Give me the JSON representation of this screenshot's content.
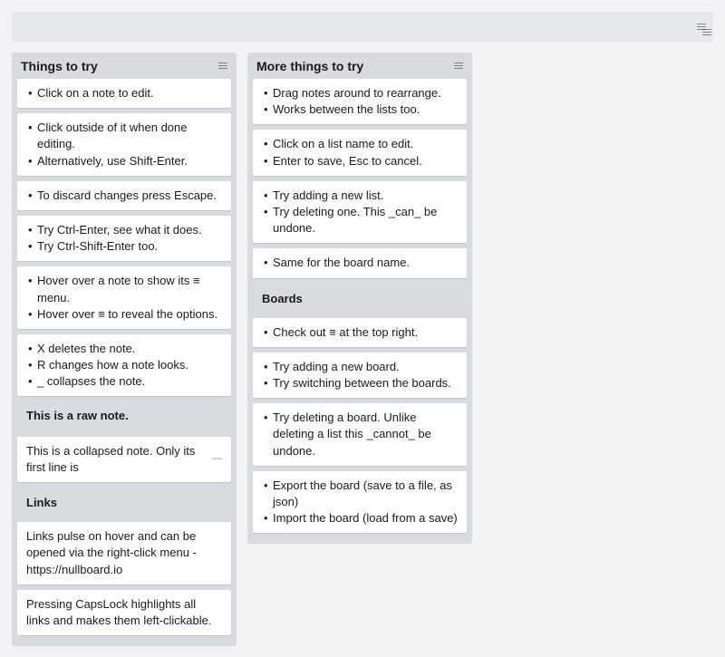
{
  "board": {
    "title": ""
  },
  "board_menu_icon": "hamburger",
  "lists": [
    {
      "title": "Things to try",
      "notes": [
        {
          "type": "bullets",
          "items": [
            "Click on a note to edit."
          ]
        },
        {
          "type": "bullets",
          "items": [
            "Click outside of it when done editing.",
            "Alternatively, use Shift-Enter."
          ]
        },
        {
          "type": "bullets",
          "items": [
            "To discard changes press Escape."
          ]
        },
        {
          "type": "bullets",
          "items": [
            "Try Ctrl-Enter, see what it does.",
            "Try Ctrl-Shift-Enter too."
          ]
        },
        {
          "type": "bullets_icon",
          "items": [
            "Hover over a note to show its  ≡  menu.",
            "Hover over  ≡  to reveal the options."
          ]
        },
        {
          "type": "bullets",
          "items": [
            "X  deletes the note.",
            "R changes how a note looks.",
            "_  collapses the note."
          ]
        },
        {
          "type": "raw",
          "text": "This is a raw note."
        },
        {
          "type": "collapsed",
          "text": "This is a collapsed note. Only its first line is"
        },
        {
          "type": "section",
          "text": "Links"
        },
        {
          "type": "plain",
          "text": "Links pulse on hover and can be opened via the right-click menu  -  https://nullboard.io"
        },
        {
          "type": "plain",
          "text": "Pressing CapsLock highlights all links and makes them left-clickable."
        }
      ]
    },
    {
      "title": "More things to try",
      "notes": [
        {
          "type": "bullets",
          "items": [
            "Drag notes around to rearrange.",
            "Works between the lists too."
          ]
        },
        {
          "type": "bullets",
          "items": [
            "Click on a list name to edit.",
            "Enter to save, Esc to cancel."
          ]
        },
        {
          "type": "bullets",
          "items": [
            "Try adding a new list.",
            "Try deleting one. This  _can_  be undone."
          ]
        },
        {
          "type": "bullets",
          "items": [
            "Same for the board name."
          ]
        },
        {
          "type": "section",
          "text": "Boards"
        },
        {
          "type": "bullets_icon",
          "items": [
            "Check out  ≡  at the top right."
          ]
        },
        {
          "type": "bullets",
          "items": [
            "Try adding a new board.",
            "Try switching between the boards."
          ]
        },
        {
          "type": "bullets",
          "items": [
            "Try deleting a board. Unlike deleting a list this  _cannot_  be undone."
          ]
        },
        {
          "type": "bullets",
          "items": [
            "Export the board  (save to a file, as json)",
            "Import the board  (load from a save)"
          ]
        }
      ]
    }
  ]
}
